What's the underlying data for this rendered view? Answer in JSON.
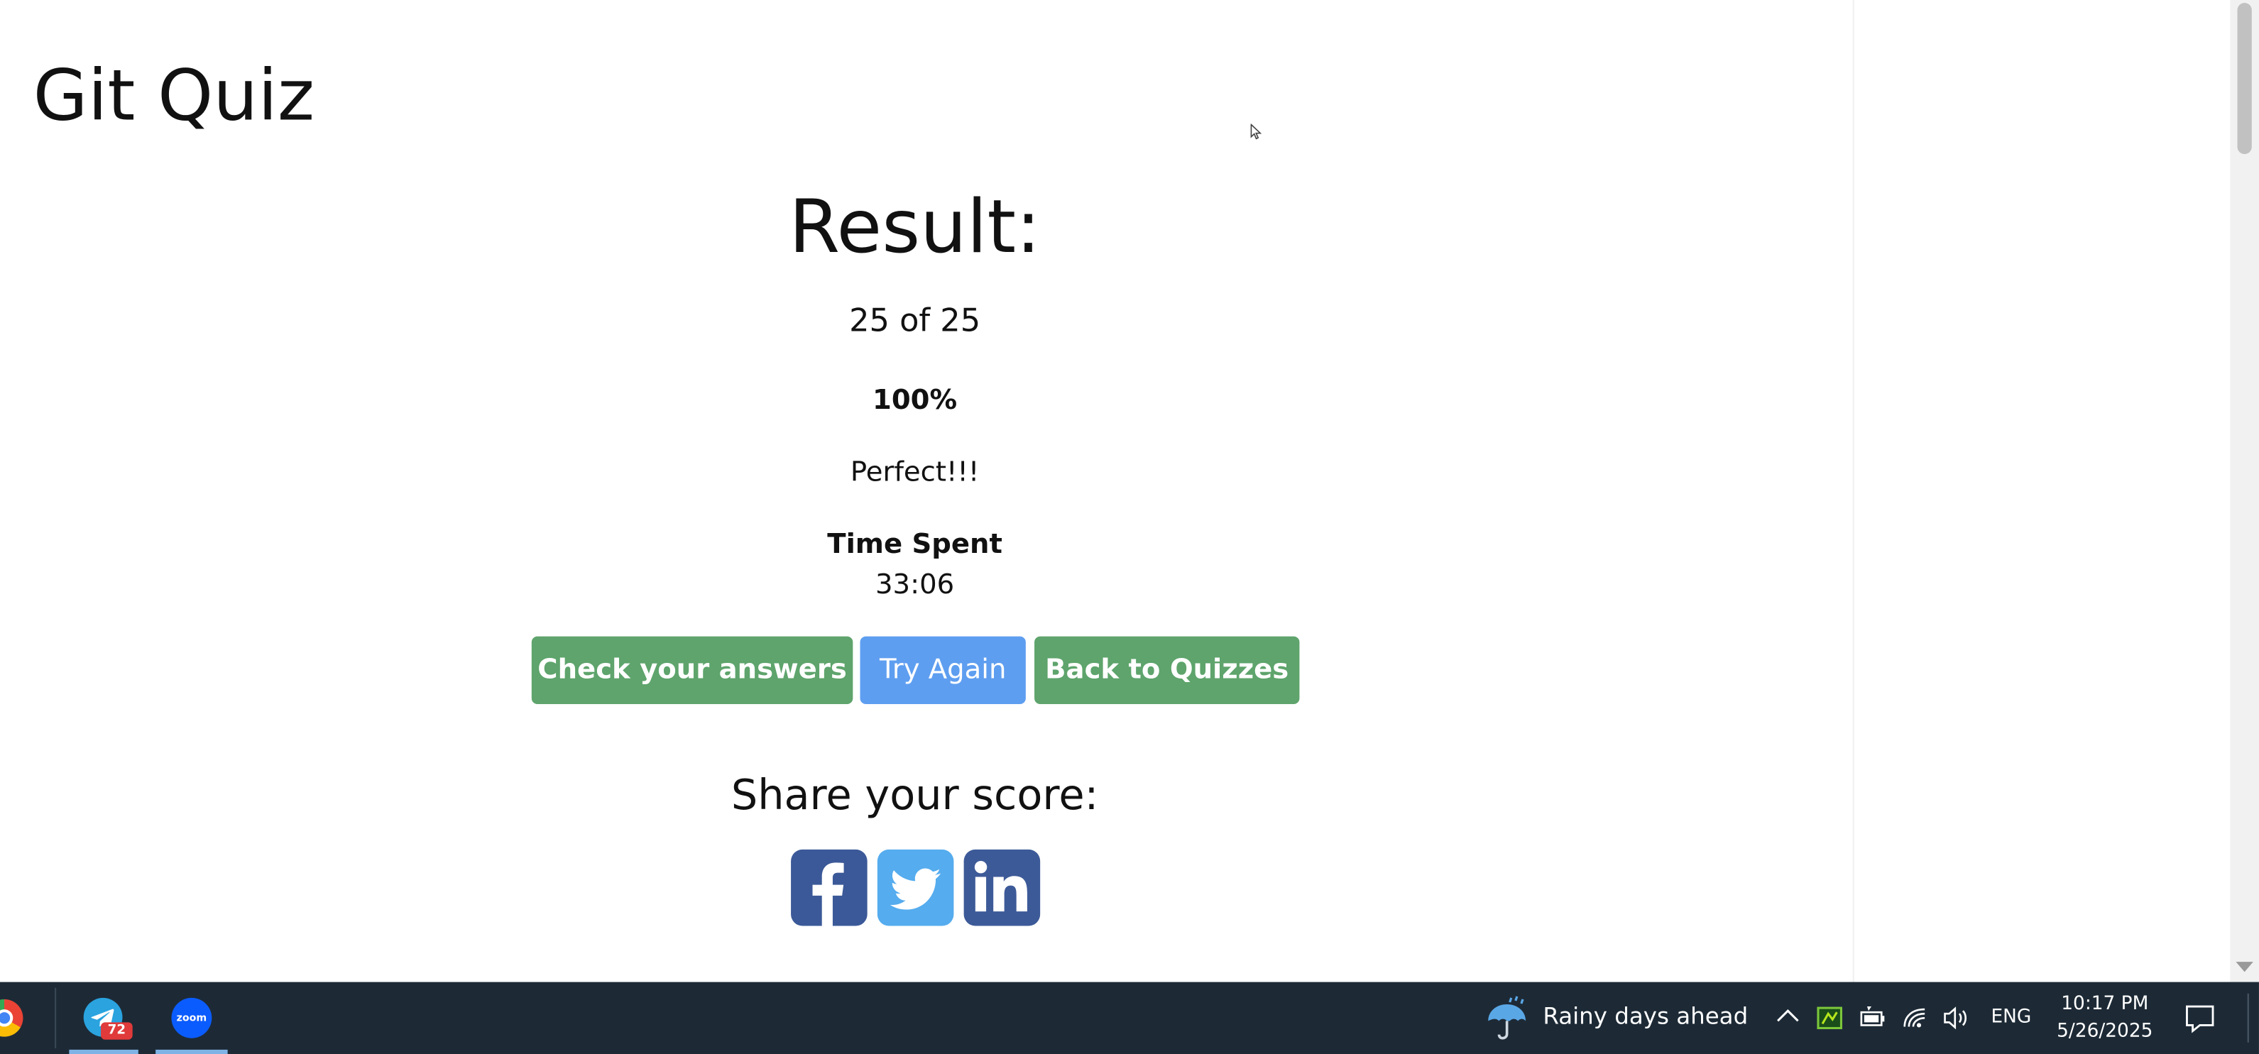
{
  "page": {
    "site_title": "Git Quiz"
  },
  "result": {
    "heading": "Result:",
    "score": "25 of 25",
    "percent": "100%",
    "message": "Perfect!!!",
    "time_label": "Time Spent",
    "time_value": "33:06"
  },
  "buttons": {
    "check_answers": "Check your answers",
    "try_again": "Try Again",
    "back_to_quizzes": "Back to Quizzes"
  },
  "share": {
    "heading": "Share your score:",
    "networks": [
      "facebook-icon",
      "twitter-icon",
      "linkedin-icon"
    ]
  },
  "colors": {
    "button_green": "#5ea46c",
    "button_blue": "#5e9ef0",
    "facebook": "#3b5998",
    "twitter": "#55acee",
    "linkedin": "#3d5a98",
    "taskbar": "#1d2a36"
  },
  "taskbar": {
    "apps": [
      "chrome-icon",
      "telegram-icon",
      "zoom-icon"
    ],
    "telegram_badge": "72",
    "zoom_label": "zoom",
    "weather_text": "Rainy days ahead",
    "language": "ENG",
    "time": "10:17 PM",
    "date": "5/26/2025"
  }
}
